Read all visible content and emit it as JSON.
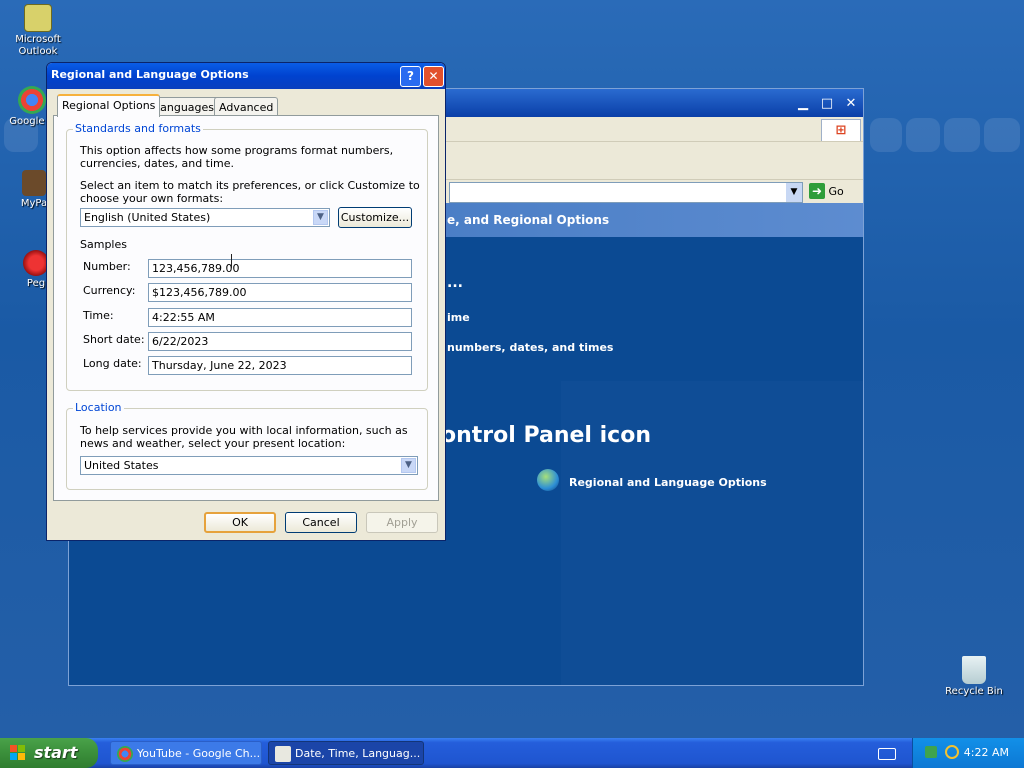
{
  "desktop": {
    "icons": [
      {
        "label": "Microsoft Outlook"
      },
      {
        "label": "Google C"
      },
      {
        "label": "MyPa"
      },
      {
        "label": "Peg"
      },
      {
        "label": "Recycle Bin"
      }
    ]
  },
  "control_panel": {
    "address_go": "Go",
    "band_text": "e, and Regional Options",
    "dots": "...",
    "task_time": "ime",
    "task_numbers": "numbers, dates, and times",
    "icon_heading": "ontrol Panel icon",
    "icon_item": "Regional and Language Options"
  },
  "dialog": {
    "title": "Regional and Language Options",
    "help": "?",
    "close": "✕",
    "tabs": [
      "Regional Options",
      "Languages",
      "Advanced"
    ],
    "standards": {
      "title": "Standards and formats",
      "desc": "This option affects how some programs format numbers, currencies, dates, and time.",
      "select_desc": "Select an item to match its preferences, or click Customize to choose your own formats:",
      "selected_format": "English (United States)",
      "customize": "Customize...",
      "samples_label": "Samples",
      "samples": [
        {
          "label": "Number:",
          "value": "123,456,789.00"
        },
        {
          "label": "Currency:",
          "value": "$123,456,789.00"
        },
        {
          "label": "Time:",
          "value": "4:22:55 AM"
        },
        {
          "label": "Short date:",
          "value": "6/22/2023"
        },
        {
          "label": "Long date:",
          "value": "Thursday, June 22, 2023"
        }
      ]
    },
    "location": {
      "title": "Location",
      "desc": "To help services provide you with local information, such as news and weather, select your present location:",
      "selected": "United States"
    },
    "buttons": {
      "ok": "OK",
      "cancel": "Cancel",
      "apply": "Apply"
    }
  },
  "taskbar": {
    "start": "start",
    "tasks": [
      "YouTube - Google Ch...",
      "Date, Time, Languag..."
    ],
    "clock": "4:22 AM"
  },
  "colors": {
    "accent": "#0046d5",
    "title_bar": "#0042cf",
    "close": "#e2502c",
    "start": "#3b8f3b"
  }
}
